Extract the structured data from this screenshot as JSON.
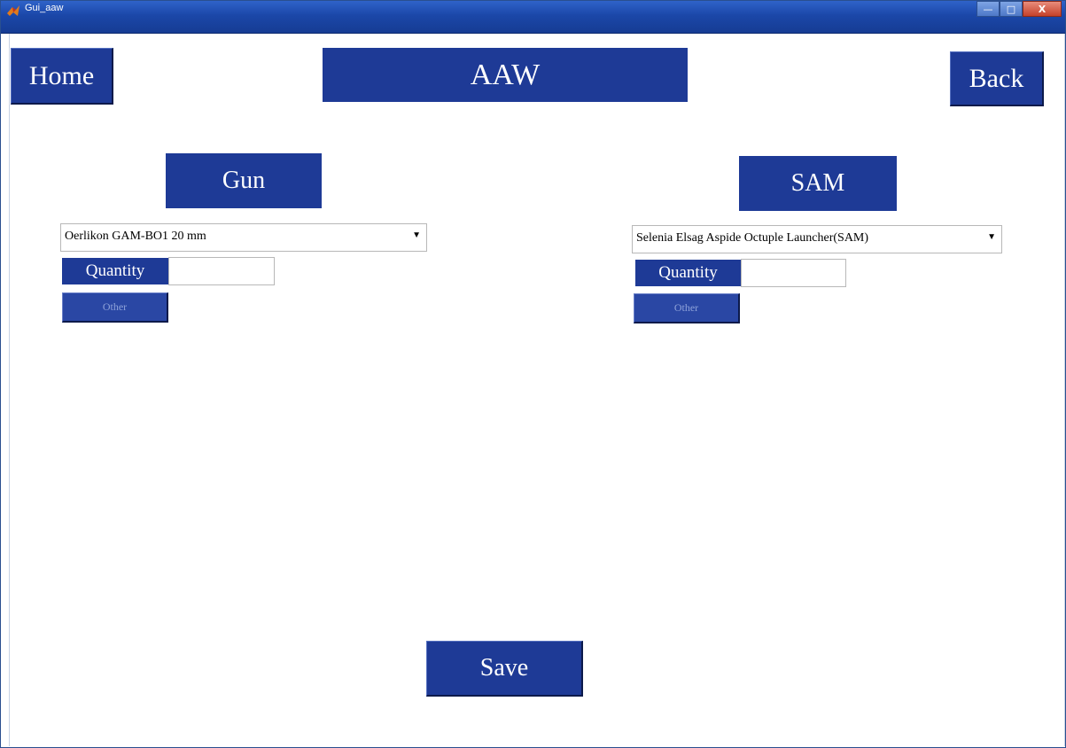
{
  "window": {
    "title": "Gui_aaw",
    "controls": [
      "—",
      "□",
      "X"
    ]
  },
  "header": {
    "home_label": "Home",
    "title": "AAW",
    "back_label": "Back"
  },
  "gun": {
    "heading": "Gun",
    "selected": "Oerlikon GAM-BO1 20 mm",
    "quantity_label": "Quantity",
    "quantity_value": "",
    "other_label": "Other"
  },
  "sam": {
    "heading": "SAM",
    "selected": "Selenia Elsag Aspide Octuple Launcher(SAM)",
    "quantity_label": "Quantity",
    "quantity_value": "",
    "other_label": "Other"
  },
  "footer": {
    "save_label": "Save"
  },
  "colors": {
    "panel_blue": "#1e3a96",
    "titlebar_blue": "#1b47a8",
    "background": "#ffffff"
  },
  "icons": {
    "app": "matlab-icon",
    "dropdown": "triangle-down-icon"
  }
}
